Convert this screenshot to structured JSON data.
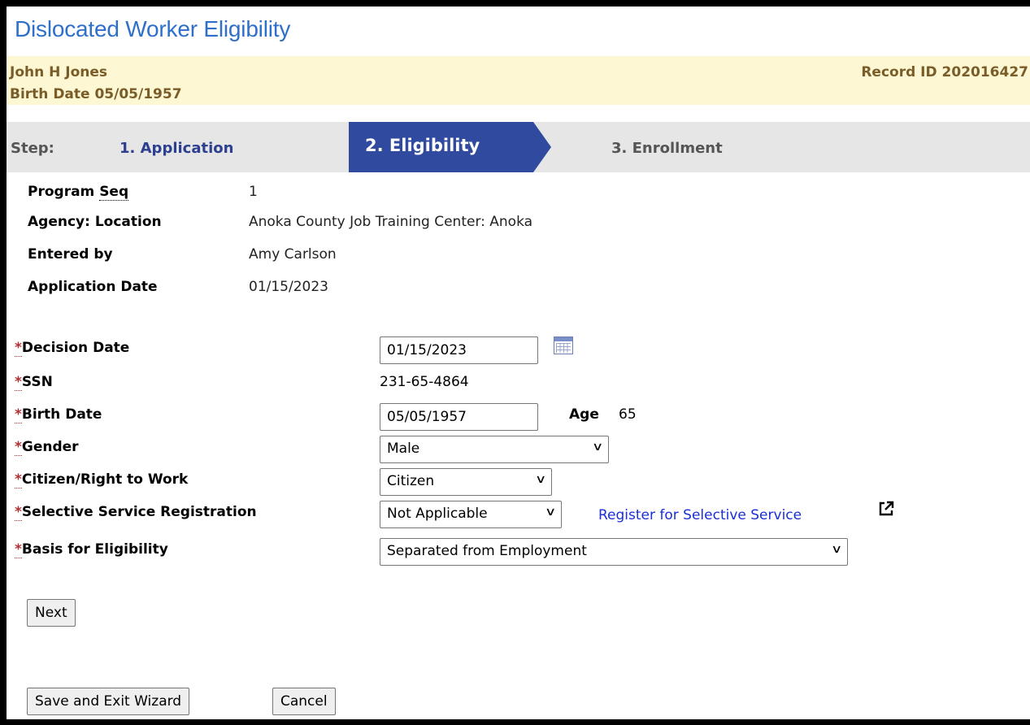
{
  "page": {
    "title": "Dislocated Worker Eligibility"
  },
  "person": {
    "name": "John H Jones",
    "birth": "Birth Date 05/05/1957",
    "record": "Record ID 202016427"
  },
  "steps": {
    "label": "Step:",
    "items": [
      "1. Application",
      "2. Eligibility",
      "3. Enrollment"
    ],
    "active_color": "#2f4a9e"
  },
  "info": {
    "program_seq_label": "Program Seq",
    "program_seq_value": "1",
    "agency_label": "Agency: Location",
    "agency_value": "Anoka County Job Training Center: Anoka",
    "entered_by_label": "Entered by",
    "entered_by_value": "Amy Carlson",
    "app_date_label": "Application Date",
    "app_date_value": "01/15/2023"
  },
  "form": {
    "required_mark": "*",
    "decision_date": {
      "label": "Decision Date",
      "value": "01/15/2023"
    },
    "ssn": {
      "label": "SSN",
      "value": "231-65-4864"
    },
    "birth_date": {
      "label": "Birth Date",
      "value": "05/05/1957",
      "age_label": "Age",
      "age_value": "65"
    },
    "gender": {
      "label": "Gender",
      "value": "Male"
    },
    "citizen": {
      "label": "Citizen/Right to Work",
      "value": "Citizen"
    },
    "selective_service": {
      "label": "Selective Service Registration",
      "value": "Not Applicable",
      "link": "Register for Selective Service"
    },
    "basis": {
      "label": "Basis for Eligibility",
      "value": "Separated from Employment"
    }
  },
  "buttons": {
    "next": "Next",
    "save_exit": "Save and Exit Wizard",
    "cancel": "Cancel"
  },
  "icons": {
    "calendar": "calendar-icon",
    "external": "external-link-icon",
    "chevron": "chevron-down-icon"
  }
}
